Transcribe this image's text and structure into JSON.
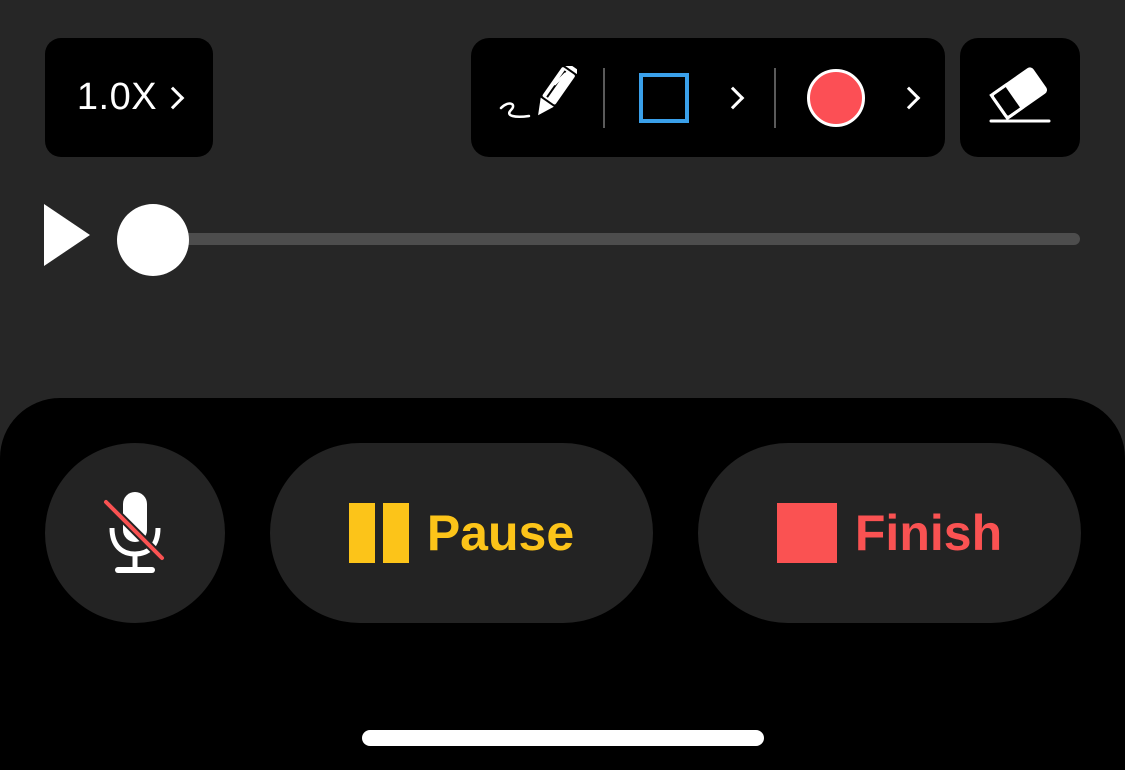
{
  "toolbar": {
    "speed_label": "1.0X",
    "speed_icon": "chevron-right-icon",
    "pen_icon": "pen-icon",
    "shape_icon": "square-icon",
    "shape_color": "#3aa0ea",
    "color_swatch": "#fc4f55",
    "eraser_icon": "eraser-icon"
  },
  "playback": {
    "play_icon": "play-icon",
    "progress": 0
  },
  "controls": {
    "mic_icon": "microphone-muted-icon",
    "pause_label": "Pause",
    "pause_color": "#fcc419",
    "finish_label": "Finish",
    "finish_color": "#fa5252"
  }
}
